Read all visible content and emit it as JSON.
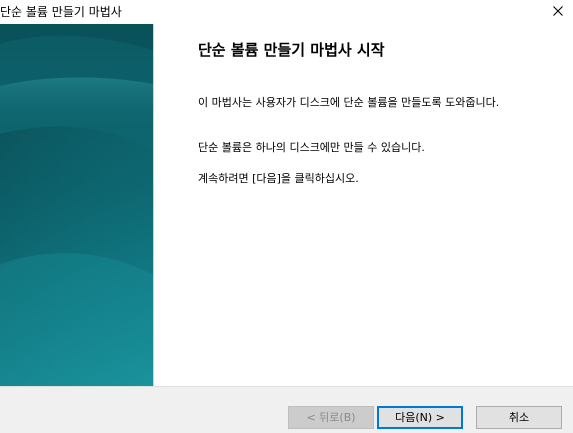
{
  "window": {
    "title": "단순 볼륨 만들기 마법사"
  },
  "main": {
    "heading": "단순 볼륨 만들기 마법사 시작",
    "paragraphs": [
      "이 마법사는 사용자가 디스크에 단순 볼륨을 만들도록 도와줍니다.",
      "단순 볼륨은 하나의 디스크에만 만들 수 있습니다.",
      "계속하려면 [다음]을 클릭하십시오."
    ]
  },
  "buttons": {
    "back": "< 뒤로(B)",
    "next": "다음(N) >",
    "cancel": "취소"
  },
  "colors": {
    "banner_dark": "#0c5a63",
    "banner_light": "#1a939d",
    "focus_border": "#0078d7"
  },
  "icons": {
    "close": "close-icon"
  }
}
